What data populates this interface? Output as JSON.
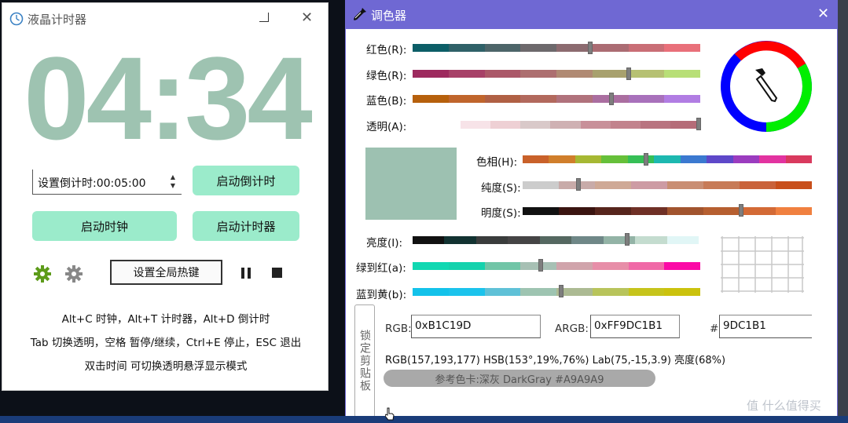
{
  "timer": {
    "title": "液晶计时器",
    "time": "04:34",
    "countdown_value": "设置倒计时:00:05:00",
    "btn_start_countdown": "启动倒计时",
    "btn_start_clock": "启动时钟",
    "btn_start_timer": "启动计时器",
    "btn_hotkey": "设置全局热键",
    "help": [
      "Alt+C 时钟，Alt+T 计时器，Alt+D 倒计时",
      "Tab 切换透明，空格 暂停/继续，Ctrl+E 停止，ESC 退出",
      "双击时间 可切换透明悬浮显示模式"
    ],
    "colors": {
      "digits": "#9ec3b1",
      "button": "#9bebcb",
      "gear_green": "#5d9b1a",
      "gear_gray": "#888888"
    }
  },
  "picker": {
    "title": "调色器",
    "labels": {
      "red": "红色(R):",
      "green": "绿色(R):",
      "blue": "蓝色(B):",
      "alpha": "透明(A):",
      "hue": "色相(H):",
      "saturation": "纯度(S):",
      "brightness": "明度(S):",
      "lightness": "亮度(I):",
      "green_red": "绿到红(a):",
      "blue_yellow": "蓝到黄(b):"
    },
    "levels": {
      "red": 157,
      "green": 193,
      "blue": 177,
      "alpha": 255,
      "hue": 0.425,
      "saturation": 0.19,
      "brightness": 0.76,
      "lightness": 0.75,
      "green_red": 0.44,
      "blue_yellow": 0.52
    },
    "lock_label": "锁定剪贴板",
    "rgb_label": "RGB:",
    "rgb_value": "0xB1C19D",
    "argb_label": "ARGB:",
    "argb_value": "0xFF9DC1B1",
    "hash_label": "#",
    "hash_value": "9DC1B1",
    "info": "RGB(157,193,177) HSB(153°,19%,76%) Lab(75,-15,3.9) 亮度(68%)",
    "reference": "参考色卡:深灰 DarkGray  #A9A9A9",
    "current_color": "#9DC1B1",
    "reference_color": "#A9A9A9",
    "title_color": "#6f68d3"
  },
  "watermark": "值 什么值得买"
}
